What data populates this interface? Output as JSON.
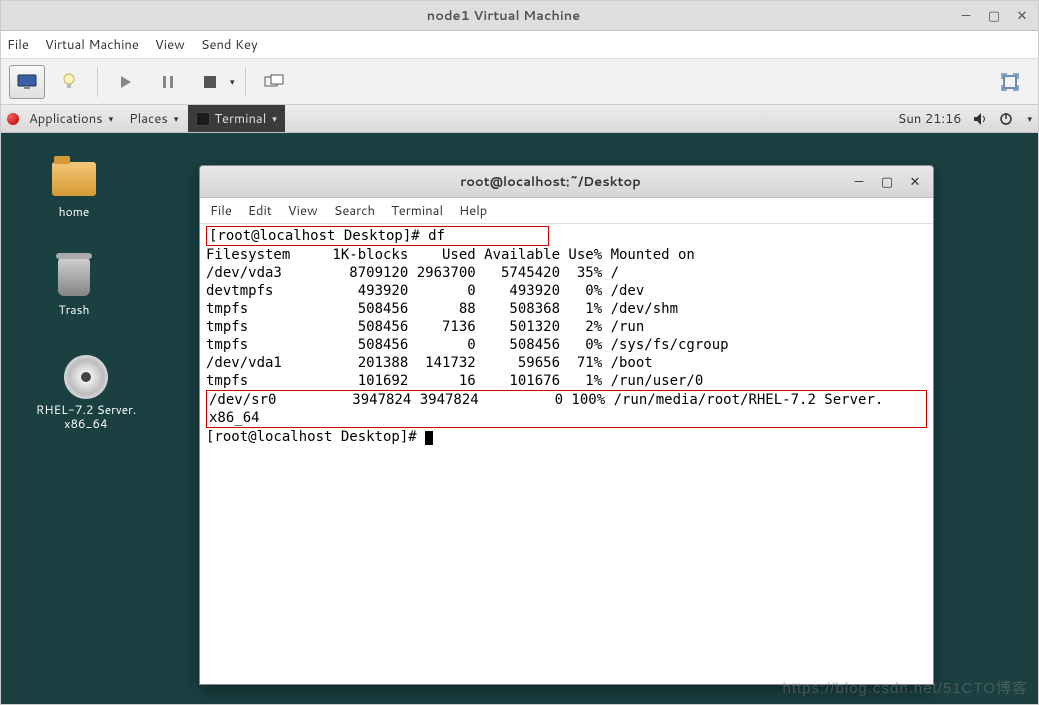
{
  "vm": {
    "title": "node1 Virtual Machine",
    "menu": {
      "file": "File",
      "virtual_machine": "Virtual Machine",
      "view": "View",
      "send_key": "Send Key"
    }
  },
  "gnome": {
    "applications": "Applications",
    "places": "Places",
    "terminal": "Terminal",
    "clock": "Sun 21:16"
  },
  "desk": {
    "home": "home",
    "trash": "Trash",
    "rhel": "RHEL-7.2 Server.\nx86_64"
  },
  "term": {
    "title": "root@localhost:~/Desktop",
    "menu": {
      "file": "File",
      "edit": "Edit",
      "view": "View",
      "search": "Search",
      "terminal": "Terminal",
      "help": "Help"
    },
    "prompt1": "[root@localhost Desktop]# df",
    "header": "Filesystem     1K-blocks    Used Available Use% Mounted on",
    "rows": [
      "/dev/vda3        8709120 2963700   5745420  35% /",
      "devtmpfs          493920       0    493920   0% /dev",
      "tmpfs             508456      88    508368   1% /dev/shm",
      "tmpfs             508456    7136    501320   2% /run",
      "tmpfs             508456       0    508456   0% /sys/fs/cgroup",
      "/dev/vda1         201388  141732     59656  71% /boot",
      "tmpfs             101692      16    101676   1% /run/user/0"
    ],
    "sr0_1": "/dev/sr0         3947824 3947824         0 100% /run/media/root/RHEL-7.2 Server.",
    "sr0_2": "x86_64",
    "prompt2": "[root@localhost Desktop]# "
  },
  "watermark": "https://blog.csdn.net/51CTO博客"
}
